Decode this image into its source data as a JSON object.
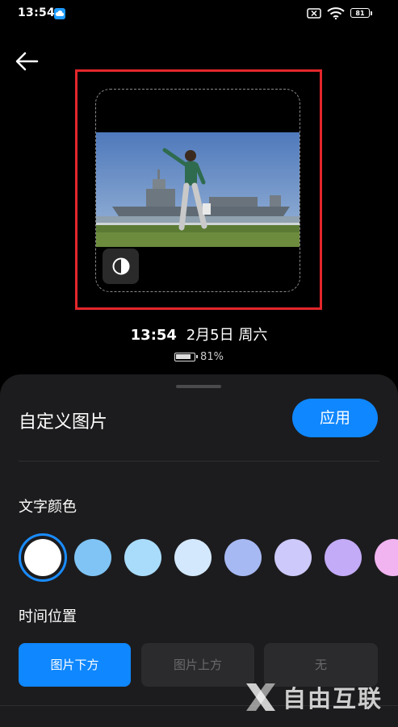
{
  "status_bar": {
    "time": "13:54",
    "battery_level": "81",
    "icons": [
      "cloud-icon",
      "sim-x-icon",
      "wifi-icon",
      "battery-icon"
    ]
  },
  "header": {
    "back_icon": "arrow-left-icon"
  },
  "preview": {
    "contrast_icon": "contrast-icon",
    "time": "13:54",
    "date": "2月5日 周六",
    "battery_percent": "81%"
  },
  "sheet": {
    "title": "自定义图片",
    "apply_label": "应用",
    "text_color_label": "文字颜色",
    "colors": [
      "#ffffff",
      "#7fc4f5",
      "#a9dcfb",
      "#d4e8fd",
      "#a7b9f3",
      "#cdc9fa",
      "#c3abf7",
      "#f1b4f0"
    ],
    "selected_color_index": 0,
    "time_position_label": "时间位置",
    "positions": [
      "图片下方",
      "图片上方",
      "无"
    ],
    "selected_position_index": 0
  },
  "watermark": {
    "text": "自由互联"
  },
  "theme": {
    "accent": "#0f87ff",
    "highlight_border": "#e3262b",
    "sheet_bg": "#1c1c1e"
  }
}
